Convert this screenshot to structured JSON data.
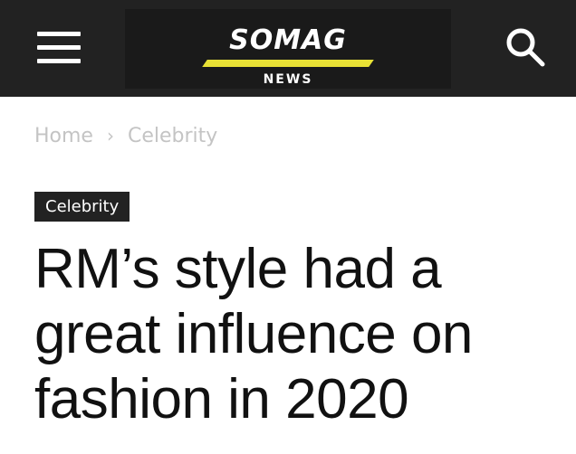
{
  "header": {
    "logo_title": "SOMAG",
    "logo_subtitle": "NEWS",
    "menu_icon": "hamburger-menu-icon",
    "search_icon": "search-icon",
    "background_color": "#222222",
    "accent_color": "#e8e135"
  },
  "breadcrumb": {
    "items": [
      "Home",
      "Celebrity"
    ],
    "separator": "›"
  },
  "article": {
    "category": "Celebrity",
    "title": "RM’s style had a great influence on fashion in 2020"
  }
}
